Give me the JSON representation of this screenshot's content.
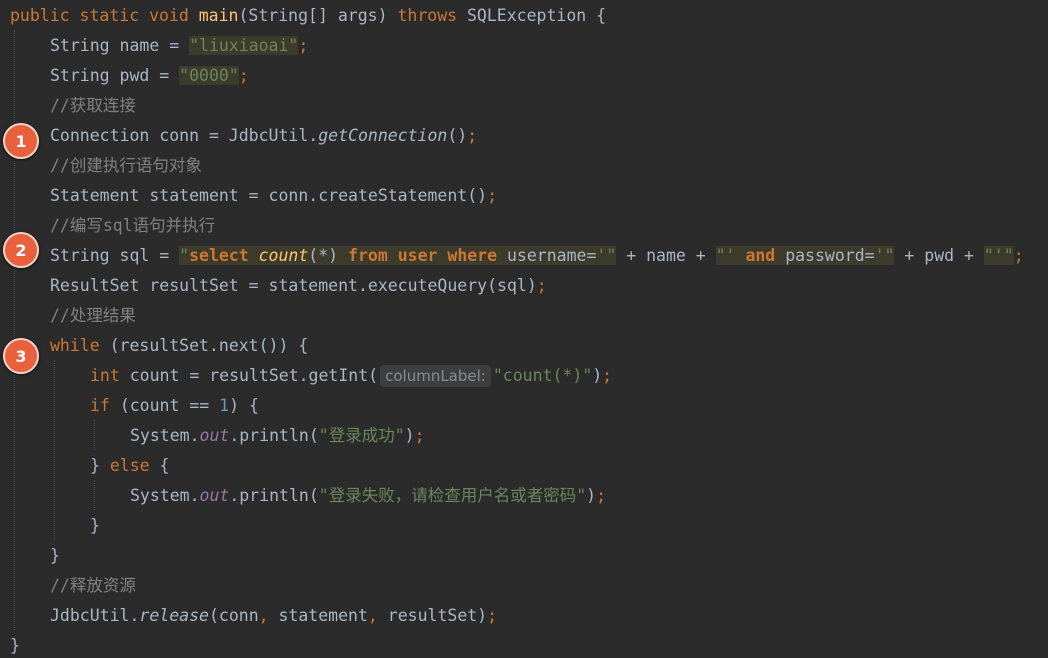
{
  "editor": {
    "lines": [
      [
        [
          "kw",
          "public static void "
        ],
        [
          "fn",
          "main"
        ],
        [
          "",
          "(String[] args) "
        ],
        [
          "kw",
          "throws "
        ],
        [
          "",
          "SQLException {"
        ]
      ],
      [
        [
          "",
          "String name = "
        ],
        [
          "str hl",
          "\"liuxiaoai\""
        ],
        [
          "kw",
          ";"
        ]
      ],
      [
        [
          "",
          "String pwd = "
        ],
        [
          "str hl",
          "\"0000\""
        ],
        [
          "kw",
          ";"
        ]
      ],
      [
        [
          "cm",
          "//获取连接"
        ]
      ],
      [
        [
          "",
          "Connection conn = JdbcUtil."
        ],
        [
          "it",
          "getConnection"
        ],
        [
          "",
          "()"
        ],
        [
          "kw",
          ";"
        ]
      ],
      [
        [
          "cm",
          "//创建执行语句对象"
        ]
      ],
      [
        [
          "",
          "Statement statement = conn.createStatement()"
        ],
        [
          "kw",
          ";"
        ]
      ],
      [
        [
          "cm",
          "//编写sql语句并执行"
        ]
      ],
      [
        [
          "",
          "String sql = "
        ],
        [
          "str hl",
          "\""
        ],
        [
          "sqlkw hl",
          "select "
        ],
        [
          "sqlfn hl",
          "count"
        ],
        [
          "hl",
          "(*) "
        ],
        [
          "sqlkw hl",
          "from user where "
        ],
        [
          "hl",
          "username="
        ],
        [
          "str hl",
          "'\""
        ],
        [
          "",
          " + name + "
        ],
        [
          "str hl",
          "\"' "
        ],
        [
          "sqlkw hl",
          "and "
        ],
        [
          "hl",
          "password="
        ],
        [
          "str hl",
          "'\""
        ],
        [
          "",
          " + pwd + "
        ],
        [
          "str hl",
          "\"'\""
        ],
        [
          "kw",
          ";"
        ]
      ],
      [
        [
          "",
          "ResultSet resultSet = statement.executeQuery(sql)"
        ],
        [
          "kw",
          ";"
        ]
      ],
      [
        [
          "cm",
          "//处理结果"
        ]
      ],
      [
        [
          "kw",
          "while "
        ],
        [
          "",
          "(resultSet.next()) {"
        ]
      ],
      [
        [
          "kw",
          "int "
        ],
        [
          "",
          "count = resultSet.getInt("
        ],
        [
          "hint",
          "columnLabel:"
        ],
        [
          "str",
          "\"count(*)\""
        ],
        [
          "",
          ")"
        ],
        [
          "kw",
          ";"
        ]
      ],
      [
        [
          "kw",
          "if "
        ],
        [
          "",
          "(count == "
        ],
        [
          "num",
          "1"
        ],
        [
          "",
          ") {"
        ]
      ],
      [
        [
          "",
          "System."
        ],
        [
          "field",
          "out"
        ],
        [
          "",
          ".println("
        ],
        [
          "str",
          "\"登录成功\""
        ],
        [
          "",
          ")"
        ],
        [
          "kw",
          ";"
        ]
      ],
      [
        [
          "",
          "} "
        ],
        [
          "kw",
          "else "
        ],
        [
          "",
          "{"
        ]
      ],
      [
        [
          "",
          "System."
        ],
        [
          "field",
          "out"
        ],
        [
          "",
          ".println("
        ],
        [
          "str",
          "\"登录失败，请检查用户名或者密码\""
        ],
        [
          "",
          ")"
        ],
        [
          "kw",
          ";"
        ]
      ],
      [
        [
          "",
          "}"
        ]
      ],
      [
        [
          "",
          "}"
        ]
      ],
      [
        [
          "cm",
          "//释放资源"
        ]
      ],
      [
        [
          "",
          "JdbcUtil."
        ],
        [
          "it",
          "release"
        ],
        [
          "",
          "(conn"
        ],
        [
          "kw",
          ", "
        ],
        [
          "",
          "statement"
        ],
        [
          "kw",
          ", "
        ],
        [
          "",
          "resultSet)"
        ],
        [
          "kw",
          ";"
        ]
      ],
      [
        [
          "",
          "}"
        ]
      ]
    ]
  },
  "badges": [
    "1",
    "2",
    "3"
  ],
  "colors": {
    "background": "#2b2b2b",
    "text": "#a9b7c6",
    "keyword": "#cc7832",
    "method": "#ffc66d",
    "string": "#6a8759",
    "number": "#6897bb",
    "comment": "#808080",
    "static_field": "#9876aa",
    "highlight": "#3d3b2c",
    "badge": "#e8603c"
  }
}
